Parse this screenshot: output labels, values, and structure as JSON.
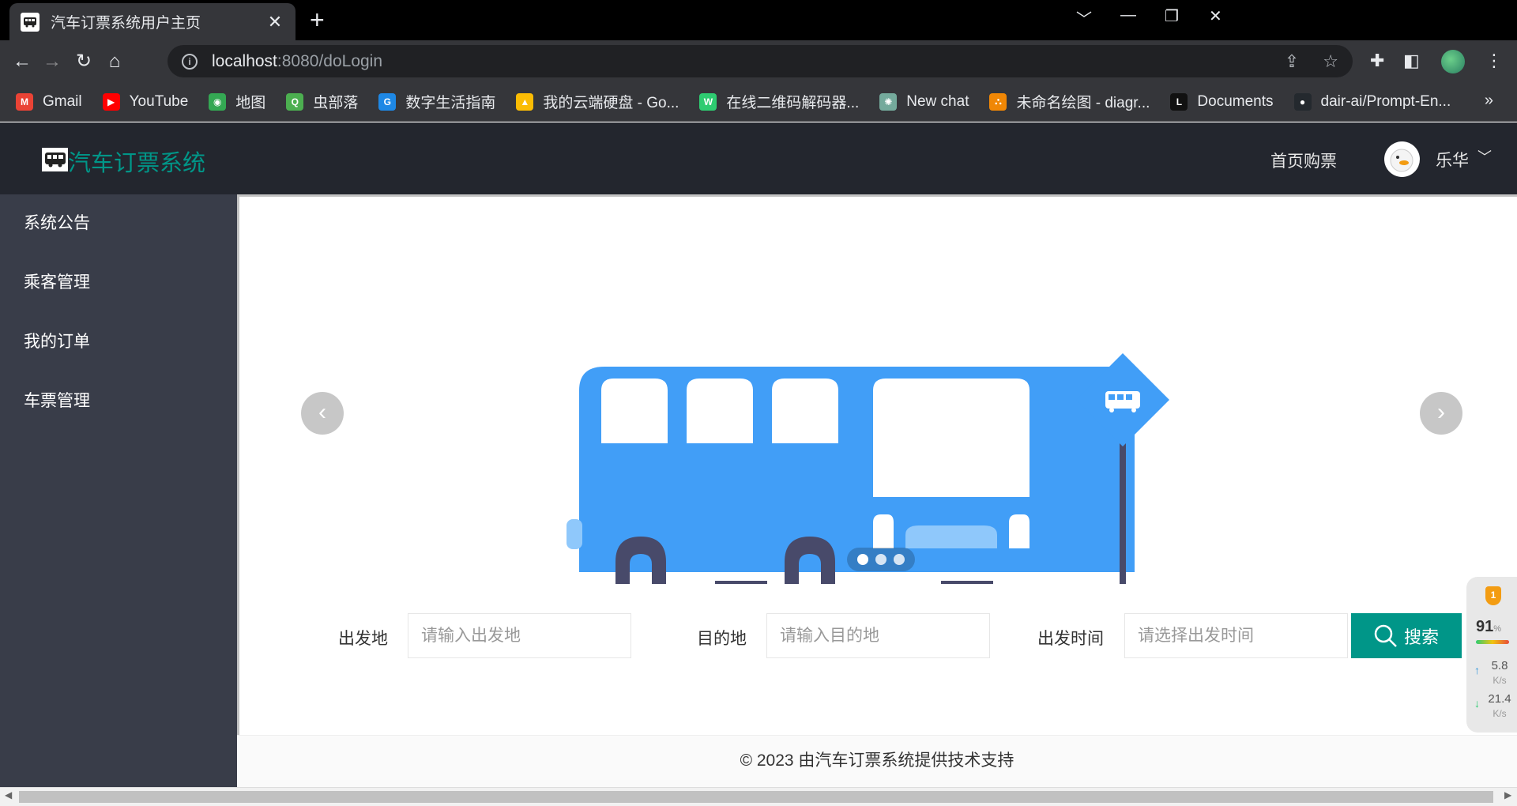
{
  "browser": {
    "tab_title": "汽车订票系统用户主页",
    "tab_close": "✕",
    "new_tab": "+",
    "url_host": "localhost",
    "url_rest": ":8080/doLogin",
    "window_controls": [
      "﹀",
      "—",
      "❐",
      "✕"
    ],
    "bookmarks": [
      {
        "label": "Gmail",
        "icon": "gmail-icon",
        "color": "#ea4335",
        "glyph": "M"
      },
      {
        "label": "YouTube",
        "icon": "youtube-icon",
        "color": "#ff0000",
        "glyph": "▶"
      },
      {
        "label": "地图",
        "icon": "maps-icon",
        "color": "#34a853",
        "glyph": "◉"
      },
      {
        "label": "虫部落",
        "icon": "chongbuluo-icon",
        "color": "#4caf50",
        "glyph": "Q"
      },
      {
        "label": "数字生活指南",
        "icon": "guide-icon",
        "color": "#1e88e5",
        "glyph": "G"
      },
      {
        "label": "我的云端硬盘 - Go...",
        "icon": "drive-icon",
        "color": "#fbbc04",
        "glyph": "▲"
      },
      {
        "label": "在线二维码解码器...",
        "icon": "qr-icon",
        "color": "#2ecc71",
        "glyph": "W"
      },
      {
        "label": "New chat",
        "icon": "chatgpt-icon",
        "color": "#74aa9c",
        "glyph": "✺"
      },
      {
        "label": "未命名绘图 - diagr...",
        "icon": "drawio-icon",
        "color": "#f08705",
        "glyph": "⛬"
      },
      {
        "label": "Documents",
        "icon": "documents-icon",
        "color": "#111111",
        "glyph": "L"
      },
      {
        "label": "dair-ai/Prompt-En...",
        "icon": "github-icon",
        "color": "#24292e",
        "glyph": "●"
      }
    ],
    "bookmarks_more": "»"
  },
  "header": {
    "logo_text": "汽车订票系统",
    "nav_home": "首页购票",
    "username": "乐华",
    "caret": "﹀"
  },
  "sidebar": {
    "items": [
      {
        "label": "系统公告"
      },
      {
        "label": "乘客管理"
      },
      {
        "label": "我的订单"
      },
      {
        "label": "车票管理"
      }
    ]
  },
  "carousel": {
    "prev": "‹",
    "next": "›",
    "slide_count": 3,
    "active_index": 0
  },
  "search": {
    "from_label": "出发地",
    "from_placeholder": "请输入出发地",
    "to_label": "目的地",
    "to_placeholder": "请输入目的地",
    "time_label": "出发时间",
    "time_placeholder": "请选择出发时间",
    "button_label": "搜索"
  },
  "footer": {
    "text": "© 2023 由汽车订票系统提供技术支持"
  },
  "widget": {
    "badge": "1",
    "percent": "91",
    "percent_unit": "%",
    "upload_value": "5.8",
    "upload_unit": "K/s",
    "download_value": "21.4",
    "download_unit": "K/s"
  },
  "colors": {
    "accent": "#009688",
    "header_bg": "#23262e",
    "sidebar_bg": "#393d49",
    "bus_blue": "#419ef7"
  }
}
